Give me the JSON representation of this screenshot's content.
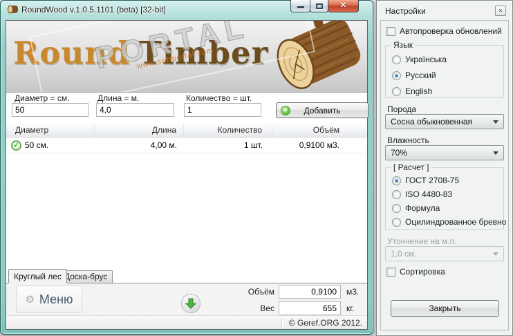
{
  "main_window": {
    "title": "RoundWood v.1.0.5.1101 (beta) [32-bit]",
    "logo": {
      "title_word1": "Round",
      "title_word2": "Timber",
      "watermark_text": "PORTAL",
      "watermark_subtext": "www.softportal.com"
    },
    "form": {
      "diameter_label": "Диаметр = см.",
      "diameter_value": "50",
      "length_label": "Длина = м.",
      "length_value": "4,0",
      "quantity_label": "Количество = шт.",
      "quantity_value": "1",
      "add_button_label": "Добавить"
    },
    "table": {
      "headers": {
        "diameter": "Диаметр",
        "length": "Длина",
        "quantity": "Количество",
        "volume": "Объём"
      },
      "rows": [
        {
          "diameter": "50 см.",
          "length": "4,00 м.",
          "quantity": "1 шт.",
          "volume": "0,9100 м3."
        }
      ]
    },
    "tabs": {
      "round_timber": "Круглый лес",
      "boards": "Доска-брус"
    },
    "footer_panel": {
      "menu_button_label": "Меню",
      "volume_label": "Объём",
      "volume_value": "0,9100",
      "volume_unit": "м3.",
      "weight_label": "Вес",
      "weight_value": "655",
      "weight_unit": "кг."
    },
    "statusbar_text": "© Geref.ORG 2012."
  },
  "settings_window": {
    "title": "Настройки",
    "autocheck_label": "Автопроверка обновлений",
    "language_group": {
      "title": "Язык",
      "options": [
        {
          "label": "Українська",
          "selected": false
        },
        {
          "label": "Русский",
          "selected": true
        },
        {
          "label": "English",
          "selected": false
        }
      ]
    },
    "species": {
      "label": "Порода",
      "value": "Сосна обыкновенная"
    },
    "humidity": {
      "label": "Влажность",
      "value": "70%"
    },
    "calculation_group": {
      "title": "[ Расчет ]",
      "options": [
        {
          "label": "ГОСТ 2708-75",
          "selected": true
        },
        {
          "label": "ISO 4480-83",
          "selected": false
        },
        {
          "label": "Формула",
          "selected": false
        },
        {
          "label": "Оцилиндрованное бревно",
          "selected": false
        }
      ]
    },
    "taper": {
      "label": "Утончение на м.п.",
      "value": "1,0 см.",
      "disabled": true
    },
    "sorting_label": "Сортировка",
    "close_button_label": "Закрыть"
  },
  "colors": {
    "aero_frame_teal": "#93d2cb",
    "close_button_red": "#c1442a",
    "logo_word1": "#c8882e",
    "logo_word2": "#6b4c1f",
    "accent_green": "#4caf3f",
    "radio_selected_blue": "#2d69a9"
  }
}
